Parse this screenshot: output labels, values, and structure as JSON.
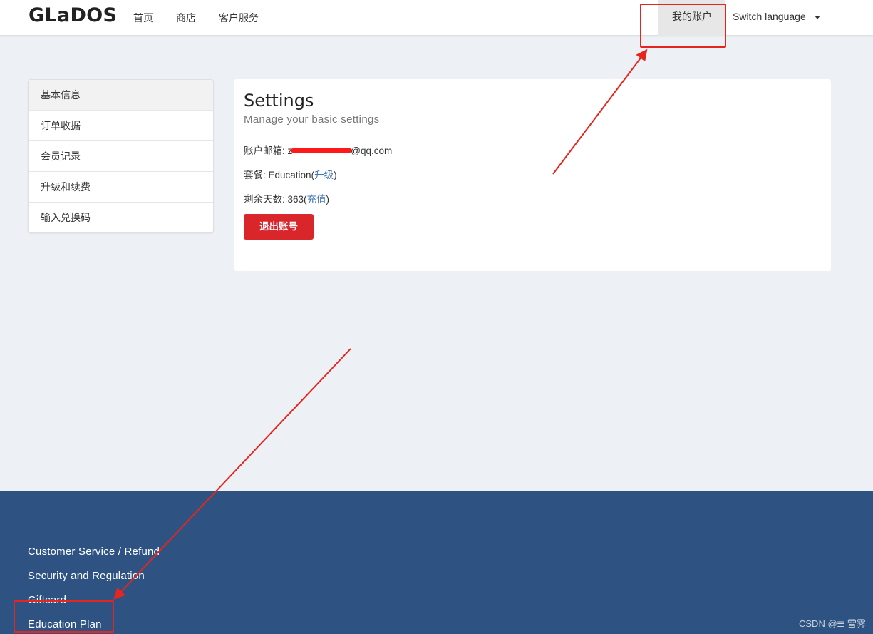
{
  "navbar": {
    "brand": "GLaDOS",
    "links": [
      "首页",
      "商店",
      "客户服务"
    ],
    "account": "我的账户",
    "language": "Switch language"
  },
  "sidebar": {
    "items": [
      "基本信息",
      "订单收据",
      "会员记录",
      "升级和续费",
      "输入兑换码"
    ]
  },
  "settings": {
    "title": "Settings",
    "subtitle": "Manage your basic settings",
    "email_label": "账户邮箱: ",
    "email_prefix": "z",
    "email_suffix": "@qq.com",
    "plan_label": "套餐: ",
    "plan_value": "Education",
    "plan_link": "升级",
    "days_label": "剩余天数: ",
    "days_value": "363",
    "days_link": "充值",
    "logout": "退出账号"
  },
  "footer": {
    "links": [
      "Customer Service / Refund",
      "Security and Regulation",
      "Giftcard",
      "Education Plan"
    ],
    "watermark": "CSDN @𝍣 雪霁"
  },
  "colors": {
    "page_bg": "#edf1f5",
    "footer_bg": "#2e5382",
    "logout_button": "#d9262b",
    "link": "#3f75b5",
    "annotation": "#e5261f"
  }
}
